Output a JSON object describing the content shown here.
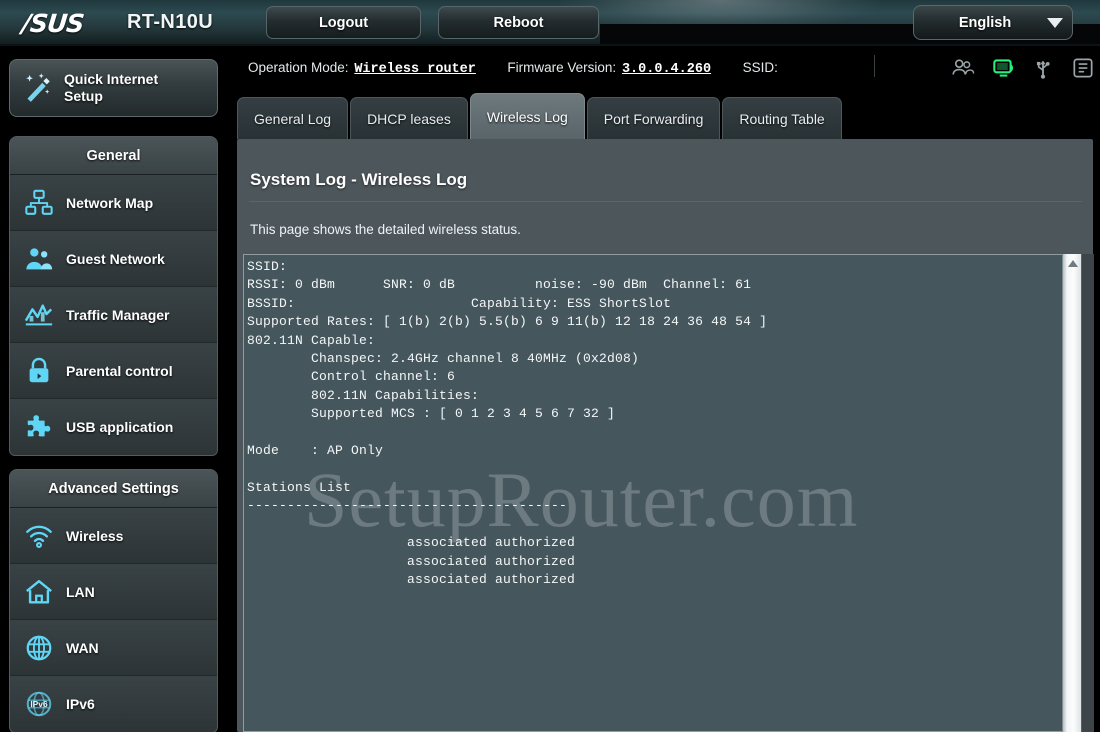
{
  "header": {
    "brand": "/SUS",
    "model": "RT-N10U",
    "logout_label": "Logout",
    "reboot_label": "Reboot",
    "language": "English",
    "accent_color": "#2c4a50"
  },
  "status": {
    "operation_mode_label": "Operation Mode:",
    "operation_mode_value": "Wireless router",
    "firmware_label": "Firmware Version:",
    "firmware_value": "3.0.0.4.260",
    "ssid_label": "SSID:",
    "ssid_value": "",
    "icons": [
      {
        "name": "clients-icon",
        "active": false
      },
      {
        "name": "connection-status-icon",
        "active": true
      },
      {
        "name": "usb-icon",
        "active": false
      },
      {
        "name": "printer-icon",
        "active": false
      }
    ],
    "active_color": "#25f07a"
  },
  "sidebar": {
    "quick_setup": {
      "label_line1": "Quick Internet",
      "label_line2": "Setup",
      "icon": "magic-wand-icon"
    },
    "groups": [
      {
        "title": "General",
        "items": [
          {
            "label": "Network Map",
            "icon": "network-map-icon"
          },
          {
            "label": "Guest Network",
            "icon": "guest-network-icon"
          },
          {
            "label": "Traffic Manager",
            "icon": "traffic-manager-icon"
          },
          {
            "label": "Parental control",
            "icon": "lock-icon"
          },
          {
            "label": "USB application",
            "icon": "puzzle-piece-icon"
          }
        ]
      },
      {
        "title": "Advanced Settings",
        "items": [
          {
            "label": "Wireless",
            "icon": "wifi-icon"
          },
          {
            "label": "LAN",
            "icon": "home-icon"
          },
          {
            "label": "WAN",
            "icon": "globe-icon"
          },
          {
            "label": "IPv6",
            "icon": "ipv6-globe-icon"
          }
        ]
      }
    ],
    "icon_color": "#5fd6f5"
  },
  "tabs": [
    {
      "label": "General Log",
      "active": false
    },
    {
      "label": "DHCP leases",
      "active": false
    },
    {
      "label": "Wireless Log",
      "active": true
    },
    {
      "label": "Port Forwarding",
      "active": false
    },
    {
      "label": "Routing Table",
      "active": false
    }
  ],
  "main": {
    "title": "System Log - Wireless Log",
    "description": "This page shows the detailed wireless status.",
    "watermark": "SetupRouter.com",
    "log_text": "SSID:\nRSSI: 0 dBm      SNR: 0 dB          noise: -90 dBm  Channel: 61\nBSSID:                      Capability: ESS ShortSlot\nSupported Rates: [ 1(b) 2(b) 5.5(b) 6 9 11(b) 12 18 24 36 48 54 ]\n802.11N Capable:\n        Chanspec: 2.4GHz channel 8 40MHz (0x2d08)\n        Control channel: 6\n        802.11N Capabilities:\n        Supported MCS : [ 0 1 2 3 4 5 6 7 32 ]\n\nMode    : AP Only\n\nStations List\n----------------------------------------\n\n                    associated authorized\n                    associated authorized\n                    associated authorized",
    "log_fields": {
      "ssid": "",
      "rssi": "0 dBm",
      "snr": "0 dB",
      "noise": "-90 dBm",
      "channel": "61",
      "bssid": "",
      "capability": "ESS ShortSlot",
      "supported_rates": "[ 1(b) 2(b) 5.5(b) 6 9 11(b) 12 18 24 36 48 54 ]",
      "chanspec": "2.4GHz channel 8 40MHz (0x2d08)",
      "control_channel": "6",
      "supported_mcs": "[ 0 1 2 3 4 5 6 7 32 ]",
      "mode": "AP Only",
      "stations": [
        {
          "status": "associated authorized"
        },
        {
          "status": "associated authorized"
        },
        {
          "status": "associated authorized"
        }
      ]
    }
  }
}
